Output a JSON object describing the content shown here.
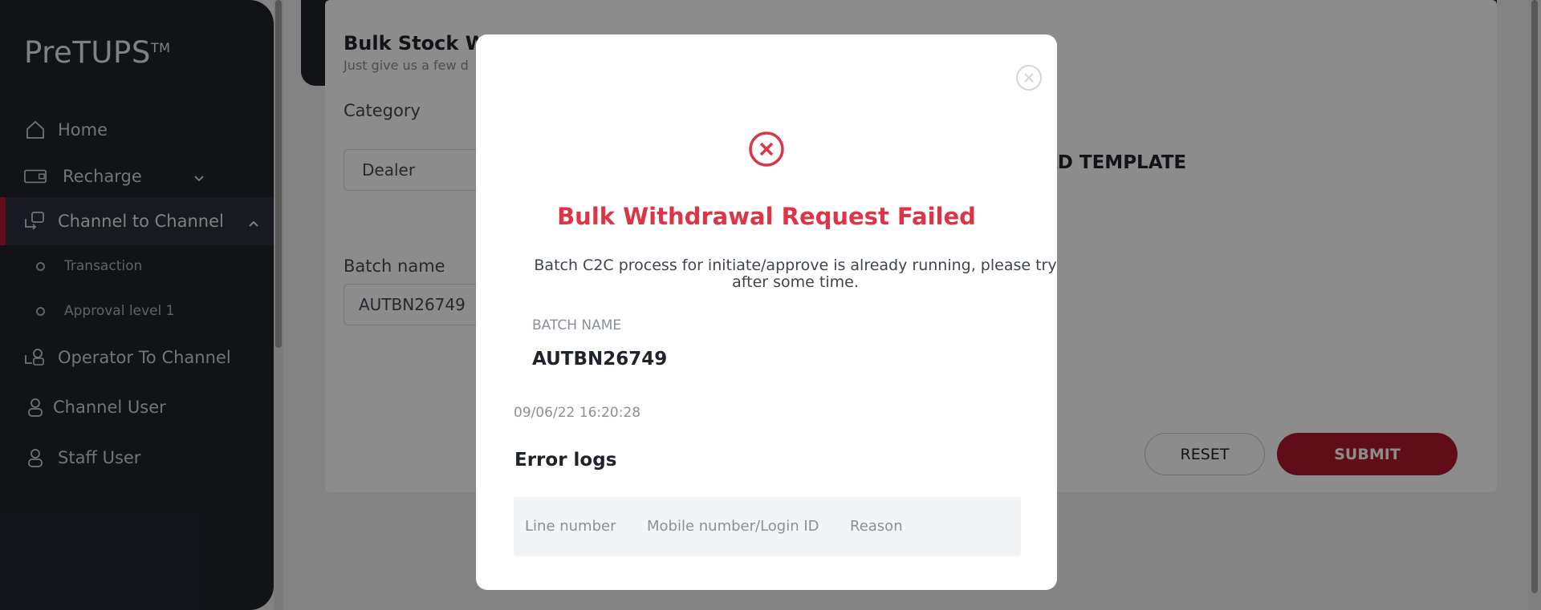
{
  "sidebar": {
    "brand": "PreTUPS",
    "brand_tm": "TM",
    "items": [
      {
        "label": "Home",
        "icon": "home-icon"
      },
      {
        "label": "Recharge",
        "icon": "recharge-icon"
      },
      {
        "label": "Channel to Channel",
        "icon": "channel-transfer-icon"
      },
      {
        "label": "Operator To Channel",
        "icon": "operator-channel-icon"
      },
      {
        "label": "Channel User",
        "icon": "user-icon"
      },
      {
        "label": "Staff User",
        "icon": "user-icon"
      }
    ],
    "subitems": [
      {
        "label": "Transaction"
      },
      {
        "label": "Approval level 1"
      }
    ]
  },
  "background": {
    "title": "Bulk Stock Wi",
    "subtitle": "Just give us a few d",
    "category_label": "Category",
    "category_value": "Dealer",
    "batch_label": "Batch name",
    "batch_value": "AUTBN26749",
    "download_template": "AD TEMPLATE",
    "reset": "RESET",
    "submit": "SUBMIT"
  },
  "modal": {
    "title": "Bulk Withdrawal Request Failed",
    "message": "Batch C2C process for initiate/approve is already running, please try after some time.",
    "batch_name_label": "BATCH NAME",
    "batch_name_value": "AUTBN26749",
    "timestamp": "09/06/22 16:20:28",
    "error_logs_title": "Error logs",
    "columns": [
      "Line number",
      "Mobile number/Login ID",
      "Reason"
    ]
  },
  "colors": {
    "sidebar_bg": "#1f242b",
    "accent": "#b0192e",
    "error": "#dc3545",
    "highlight": "#e2a63a"
  }
}
